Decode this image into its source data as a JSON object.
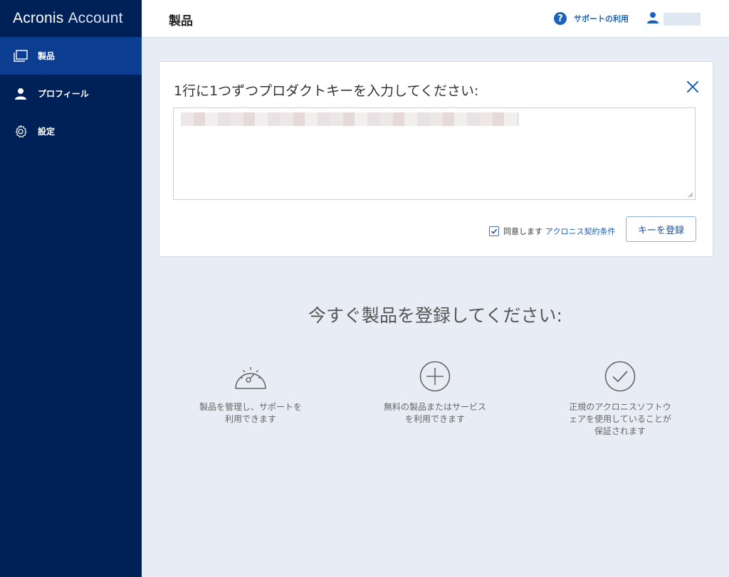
{
  "brand": {
    "name_part1": "Acronis",
    "name_part2": "Account"
  },
  "sidebar": {
    "items": [
      {
        "label": "製品",
        "icon": "products-icon",
        "active": true
      },
      {
        "label": "プロフィール",
        "icon": "user-icon",
        "active": false
      },
      {
        "label": "設定",
        "icon": "gear-icon",
        "active": false
      }
    ]
  },
  "header": {
    "title": "製品",
    "support_label": "サポートの利用",
    "support_icon_glyph": "?"
  },
  "card": {
    "title": "1行に1つずつプロダクトキーを入力してください:",
    "agree_label": "同意します",
    "terms_link": "アクロニス契約条件",
    "register_button": "キーを登録"
  },
  "promo": {
    "title": "今すぐ製品を登録してください:",
    "features": [
      {
        "icon": "speedometer-icon",
        "text": "製品を管理し、サポートを利用できます"
      },
      {
        "icon": "plus-circle-icon",
        "text": "無料の製品またはサービスを利用できます"
      },
      {
        "icon": "check-circle-icon",
        "text": "正規のアクロニスソフトウェアを使用していることが保証されます"
      }
    ]
  },
  "colors": {
    "sidebar_bg": "#002158",
    "sidebar_active": "#0b3d91",
    "accent": "#1c62b8",
    "page_bg": "#e8ecf4"
  }
}
